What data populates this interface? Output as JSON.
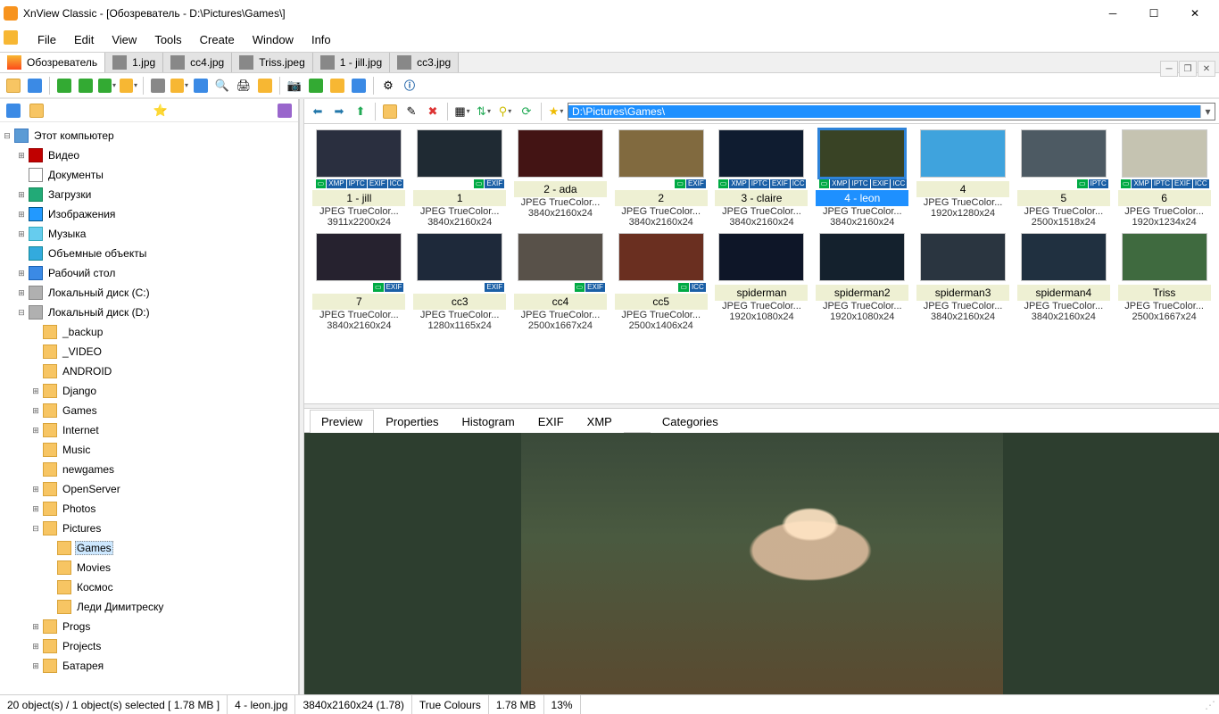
{
  "title": "XnView Classic - [Обозреватель - D:\\Pictures\\Games\\]",
  "menus": [
    "File",
    "Edit",
    "View",
    "Tools",
    "Create",
    "Window",
    "Info"
  ],
  "tabs": [
    {
      "label": "Обозреватель",
      "browser": true,
      "active": true
    },
    {
      "label": "1.jpg"
    },
    {
      "label": "cc4.jpg"
    },
    {
      "label": "Triss.jpeg"
    },
    {
      "label": "1 - jill.jpg"
    },
    {
      "label": "cc3.jpg"
    }
  ],
  "address_path": "D:\\Pictures\\Games\\",
  "tree": [
    {
      "t": "⊟",
      "ind": 0,
      "icon": "pc",
      "label": "Этот компьютер"
    },
    {
      "t": "⊞",
      "ind": 1,
      "icon": "video",
      "label": "Видео"
    },
    {
      "t": "",
      "ind": 1,
      "icon": "doc",
      "label": "Документы"
    },
    {
      "t": "⊞",
      "ind": 1,
      "icon": "dl",
      "label": "Загрузки"
    },
    {
      "t": "⊞",
      "ind": 1,
      "icon": "pic",
      "label": "Изображения"
    },
    {
      "t": "⊞",
      "ind": 1,
      "icon": "music",
      "label": "Музыка"
    },
    {
      "t": "",
      "ind": 1,
      "icon": "cube",
      "label": "Объемные объекты"
    },
    {
      "t": "⊞",
      "ind": 1,
      "icon": "desk",
      "label": "Рабочий стол"
    },
    {
      "t": "⊞",
      "ind": 1,
      "icon": "disk",
      "label": "Локальный диск (C:)"
    },
    {
      "t": "⊟",
      "ind": 1,
      "icon": "disk",
      "label": "Локальный диск (D:)"
    },
    {
      "t": "",
      "ind": 2,
      "icon": "",
      "label": "_backup"
    },
    {
      "t": "",
      "ind": 2,
      "icon": "",
      "label": "_VIDEO"
    },
    {
      "t": "",
      "ind": 2,
      "icon": "",
      "label": "ANDROID"
    },
    {
      "t": "⊞",
      "ind": 2,
      "icon": "",
      "label": "Django"
    },
    {
      "t": "⊞",
      "ind": 2,
      "icon": "",
      "label": "Games"
    },
    {
      "t": "⊞",
      "ind": 2,
      "icon": "",
      "label": "Internet"
    },
    {
      "t": "",
      "ind": 2,
      "icon": "",
      "label": "Music"
    },
    {
      "t": "",
      "ind": 2,
      "icon": "",
      "label": "newgames"
    },
    {
      "t": "⊞",
      "ind": 2,
      "icon": "",
      "label": "OpenServer"
    },
    {
      "t": "⊞",
      "ind": 2,
      "icon": "",
      "label": "Photos"
    },
    {
      "t": "⊟",
      "ind": 2,
      "icon": "",
      "label": "Pictures"
    },
    {
      "t": "",
      "ind": 3,
      "icon": "",
      "label": "Games",
      "selected": true
    },
    {
      "t": "",
      "ind": 3,
      "icon": "",
      "label": "Movies"
    },
    {
      "t": "",
      "ind": 3,
      "icon": "",
      "label": "Космос"
    },
    {
      "t": "",
      "ind": 3,
      "icon": "",
      "label": "Леди Димитреску"
    },
    {
      "t": "⊞",
      "ind": 2,
      "icon": "",
      "label": "Progs"
    },
    {
      "t": "⊞",
      "ind": 2,
      "icon": "",
      "label": "Projects"
    },
    {
      "t": "⊞",
      "ind": 2,
      "icon": "",
      "label": "Батарея"
    }
  ],
  "thumbs": [
    {
      "name": "1 - jill",
      "format": "JPEG TrueColor...",
      "dim": "3911x2200x24",
      "badges": [
        "XMP",
        "IPTC",
        "EXIF",
        "ICC"
      ],
      "bg": "#2a2f3f",
      "min": true
    },
    {
      "name": "1",
      "format": "JPEG TrueColor...",
      "dim": "3840x2160x24",
      "badges": [
        "EXIF"
      ],
      "bg": "#1f2a33",
      "min": true
    },
    {
      "name": "2 - ada",
      "format": "JPEG TrueColor...",
      "dim": "3840x2160x24",
      "badges": [],
      "bg": "#431414"
    },
    {
      "name": "2",
      "format": "JPEG TrueColor...",
      "dim": "3840x2160x24",
      "badges": [
        "EXIF"
      ],
      "bg": "#816a3f",
      "min": true
    },
    {
      "name": "3 - claire",
      "format": "JPEG TrueColor...",
      "dim": "3840x2160x24",
      "badges": [
        "XMP",
        "IPTC",
        "EXIF",
        "ICC"
      ],
      "bg": "#0f1c30",
      "min": true
    },
    {
      "name": "4 - leon",
      "format": "JPEG TrueColor...",
      "dim": "3840x2160x24",
      "badges": [
        "XMP",
        "IPTC",
        "EXIF",
        "ICC"
      ],
      "selected": true,
      "bg": "#394325",
      "min": true
    },
    {
      "name": "4",
      "format": "JPEG TrueColor...",
      "dim": "1920x1280x24",
      "badges": [],
      "bg": "#3fa3dd"
    },
    {
      "name": "5",
      "format": "JPEG TrueColor...",
      "dim": "2500x1518x24",
      "badges": [
        "IPTC"
      ],
      "bg": "#4d5a63",
      "min": true
    },
    {
      "name": "6",
      "format": "JPEG TrueColor...",
      "dim": "1920x1234x24",
      "badges": [
        "XMP",
        "IPTC",
        "EXIF",
        "ICC"
      ],
      "bg": "#c5c3b1",
      "min": true
    },
    {
      "name": "7",
      "format": "JPEG TrueColor...",
      "dim": "3840x2160x24",
      "badges": [
        "EXIF"
      ],
      "bg": "#26222f",
      "min": true
    },
    {
      "name": "cc3",
      "format": "JPEG TrueColor...",
      "dim": "1280x1165x24",
      "badges": [
        "EXIF"
      ],
      "bg": "#1e293a"
    },
    {
      "name": "cc4",
      "format": "JPEG TrueColor...",
      "dim": "2500x1667x24",
      "badges": [
        "EXIF"
      ],
      "bg": "#585149",
      "min": true
    },
    {
      "name": "cc5",
      "format": "JPEG TrueColor...",
      "dim": "2500x1406x24",
      "badges": [
        "ICC"
      ],
      "bg": "#6a2f20",
      "min": true
    },
    {
      "name": "spiderman",
      "format": "JPEG TrueColor...",
      "dim": "1920x1080x24",
      "badges": [],
      "bg": "#0e1628"
    },
    {
      "name": "spiderman2",
      "format": "JPEG TrueColor...",
      "dim": "1920x1080x24",
      "badges": [],
      "bg": "#14212d"
    },
    {
      "name": "spiderman3",
      "format": "JPEG TrueColor...",
      "dim": "3840x2160x24",
      "badges": [],
      "bg": "#2a3540"
    },
    {
      "name": "spiderman4",
      "format": "JPEG TrueColor...",
      "dim": "3840x2160x24",
      "badges": [],
      "bg": "#203040"
    },
    {
      "name": "Triss",
      "format": "JPEG TrueColor...",
      "dim": "2500x1667x24",
      "badges": [],
      "bg": "#3f6a3f"
    }
  ],
  "info_tabs": [
    "Preview",
    "Properties",
    "Histogram",
    "EXIF",
    "XMP"
  ],
  "info_tab_extra": "Categories",
  "status": {
    "sel": "20 object(s) / 1 object(s) selected  [ 1.78 MB ]",
    "file": "4 - leon.jpg",
    "dim": "3840x2160x24 (1.78)",
    "cols": "True Colours",
    "size": "1.78 MB",
    "zoom": "13%"
  }
}
